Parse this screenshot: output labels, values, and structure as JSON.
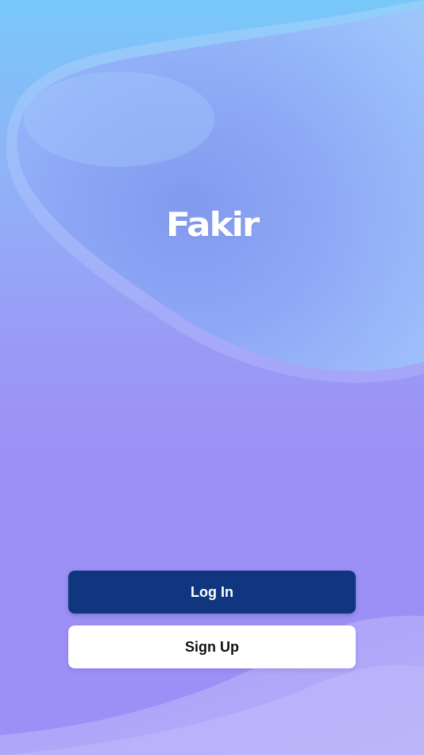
{
  "app": {
    "logo_text": "Fakir"
  },
  "actions": {
    "login_label": "Log In",
    "signup_label": "Sign Up"
  },
  "colors": {
    "background_top": "#78c8f9",
    "background_bottom": "#9c90f6",
    "login_button": "#10367f",
    "signup_button": "#ffffff"
  }
}
